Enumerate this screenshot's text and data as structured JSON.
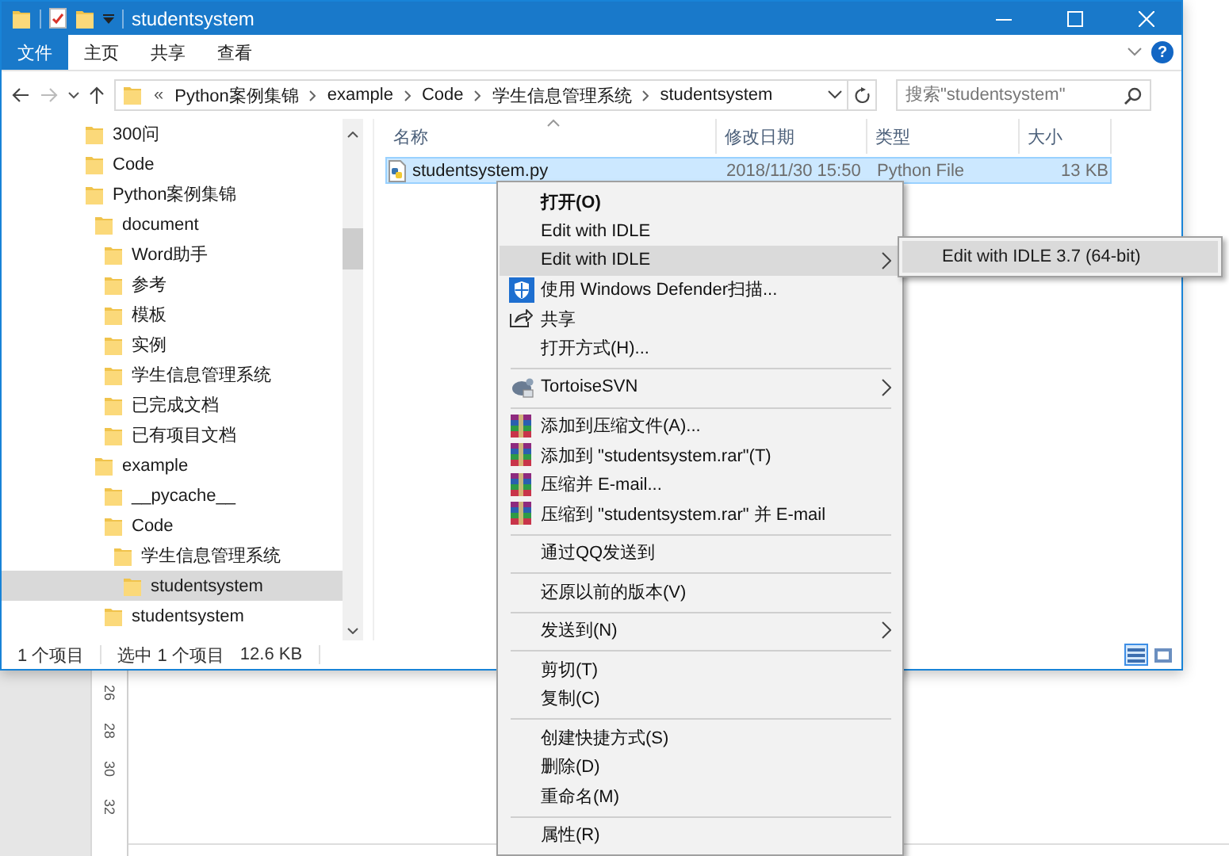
{
  "background_document": {
    "ruler_labels": [
      "26",
      "28",
      "30",
      "32"
    ]
  },
  "window": {
    "title": "studentsystem",
    "help_label": "?",
    "ribbon_tabs": [
      {
        "label": "文件",
        "selected": true
      },
      {
        "label": "主页",
        "selected": false
      },
      {
        "label": "共享",
        "selected": false
      },
      {
        "label": "查看",
        "selected": false
      }
    ]
  },
  "address_bar": {
    "overflow_label": "«",
    "path": [
      "Python案例集锦",
      "example",
      "Code",
      "学生信息管理系统",
      "studentsystem"
    ]
  },
  "search": {
    "placeholder": "搜索\"studentsystem\""
  },
  "nav_tree": [
    {
      "label": "300问",
      "selected": false
    },
    {
      "label": "Code",
      "selected": false
    },
    {
      "label": "Python案例集锦",
      "selected": false,
      "children": [
        {
          "label": "document",
          "selected": false,
          "children": [
            {
              "label": "Word助手",
              "selected": false
            },
            {
              "label": "参考",
              "selected": false
            },
            {
              "label": "模板",
              "selected": false
            },
            {
              "label": "实例",
              "selected": false
            },
            {
              "label": "学生信息管理系统",
              "selected": false
            },
            {
              "label": "已完成文档",
              "selected": false
            },
            {
              "label": "已有项目文档",
              "selected": false
            }
          ]
        },
        {
          "label": "example",
          "selected": false,
          "children": [
            {
              "label": "__pycache__",
              "selected": false
            },
            {
              "label": "Code",
              "selected": false,
              "children": [
                {
                  "label": "学生信息管理系统",
                  "selected": false,
                  "children": [
                    {
                      "label": "studentsystem",
                      "selected": true
                    }
                  ]
                }
              ]
            },
            {
              "label": "studentsystem",
              "selected": false
            }
          ]
        }
      ]
    }
  ],
  "file_list": {
    "columns": [
      "名称",
      "修改日期",
      "类型",
      "大小"
    ],
    "rows": [
      {
        "name": "studentsystem.py",
        "modified": "2018/11/30 15:50",
        "type": "Python File",
        "size": "13 KB",
        "selected": true
      }
    ]
  },
  "status_bar": {
    "item_count": "1 个项目",
    "selection": "选中 1 个项目",
    "selection_size": "12.6 KB"
  },
  "context_menu": {
    "items": [
      {
        "kind": "plain",
        "label": "打开(O)",
        "default": true,
        "selected": false,
        "submenu": false
      },
      {
        "kind": "plain",
        "label": "Edit with IDLE",
        "default": false,
        "selected": false,
        "submenu": false
      },
      {
        "kind": "plain",
        "label": "Edit with IDLE",
        "default": false,
        "selected": true,
        "submenu": true
      },
      {
        "kind": "defender",
        "label": "使用 Windows Defender扫描...",
        "default": false,
        "selected": false,
        "submenu": false
      },
      {
        "kind": "share",
        "label": "共享",
        "default": false,
        "selected": false,
        "submenu": false
      },
      {
        "kind": "plain",
        "label": "打开方式(H)...",
        "default": false,
        "selected": false,
        "submenu": false
      },
      {
        "kind": "separator"
      },
      {
        "kind": "svn",
        "label": "TortoiseSVN",
        "default": false,
        "selected": false,
        "submenu": true
      },
      {
        "kind": "separator"
      },
      {
        "kind": "archive",
        "label": "添加到压缩文件(A)...",
        "default": false,
        "selected": false,
        "submenu": false
      },
      {
        "kind": "archive",
        "label": "添加到 \"studentsystem.rar\"(T)",
        "default": false,
        "selected": false,
        "submenu": false
      },
      {
        "kind": "archive",
        "label": "压缩并 E-mail...",
        "default": false,
        "selected": false,
        "submenu": false
      },
      {
        "kind": "archive",
        "label": "压缩到 \"studentsystem.rar\" 并 E-mail",
        "default": false,
        "selected": false,
        "submenu": false
      },
      {
        "kind": "separator"
      },
      {
        "kind": "plain",
        "label": "通过QQ发送到",
        "default": false,
        "selected": false,
        "submenu": false
      },
      {
        "kind": "separator"
      },
      {
        "kind": "plain",
        "label": "还原以前的版本(V)",
        "default": false,
        "selected": false,
        "submenu": false
      },
      {
        "kind": "separator"
      },
      {
        "kind": "plain",
        "label": "发送到(N)",
        "default": false,
        "selected": false,
        "submenu": true
      },
      {
        "kind": "separator"
      },
      {
        "kind": "plain",
        "label": "剪切(T)",
        "default": false,
        "selected": false,
        "submenu": false
      },
      {
        "kind": "plain",
        "label": "复制(C)",
        "default": false,
        "selected": false,
        "submenu": false
      },
      {
        "kind": "separator"
      },
      {
        "kind": "plain",
        "label": "创建快捷方式(S)",
        "default": false,
        "selected": false,
        "submenu": false
      },
      {
        "kind": "plain",
        "label": "删除(D)",
        "default": false,
        "selected": false,
        "submenu": false
      },
      {
        "kind": "plain",
        "label": "重命名(M)",
        "default": false,
        "selected": false,
        "submenu": false
      },
      {
        "kind": "separator"
      },
      {
        "kind": "plain",
        "label": "属性(R)",
        "default": false,
        "selected": false,
        "submenu": false
      }
    ]
  },
  "submenu": {
    "items": [
      {
        "label": "Edit with IDLE 3.7 (64-bit)",
        "selected": true
      }
    ]
  }
}
